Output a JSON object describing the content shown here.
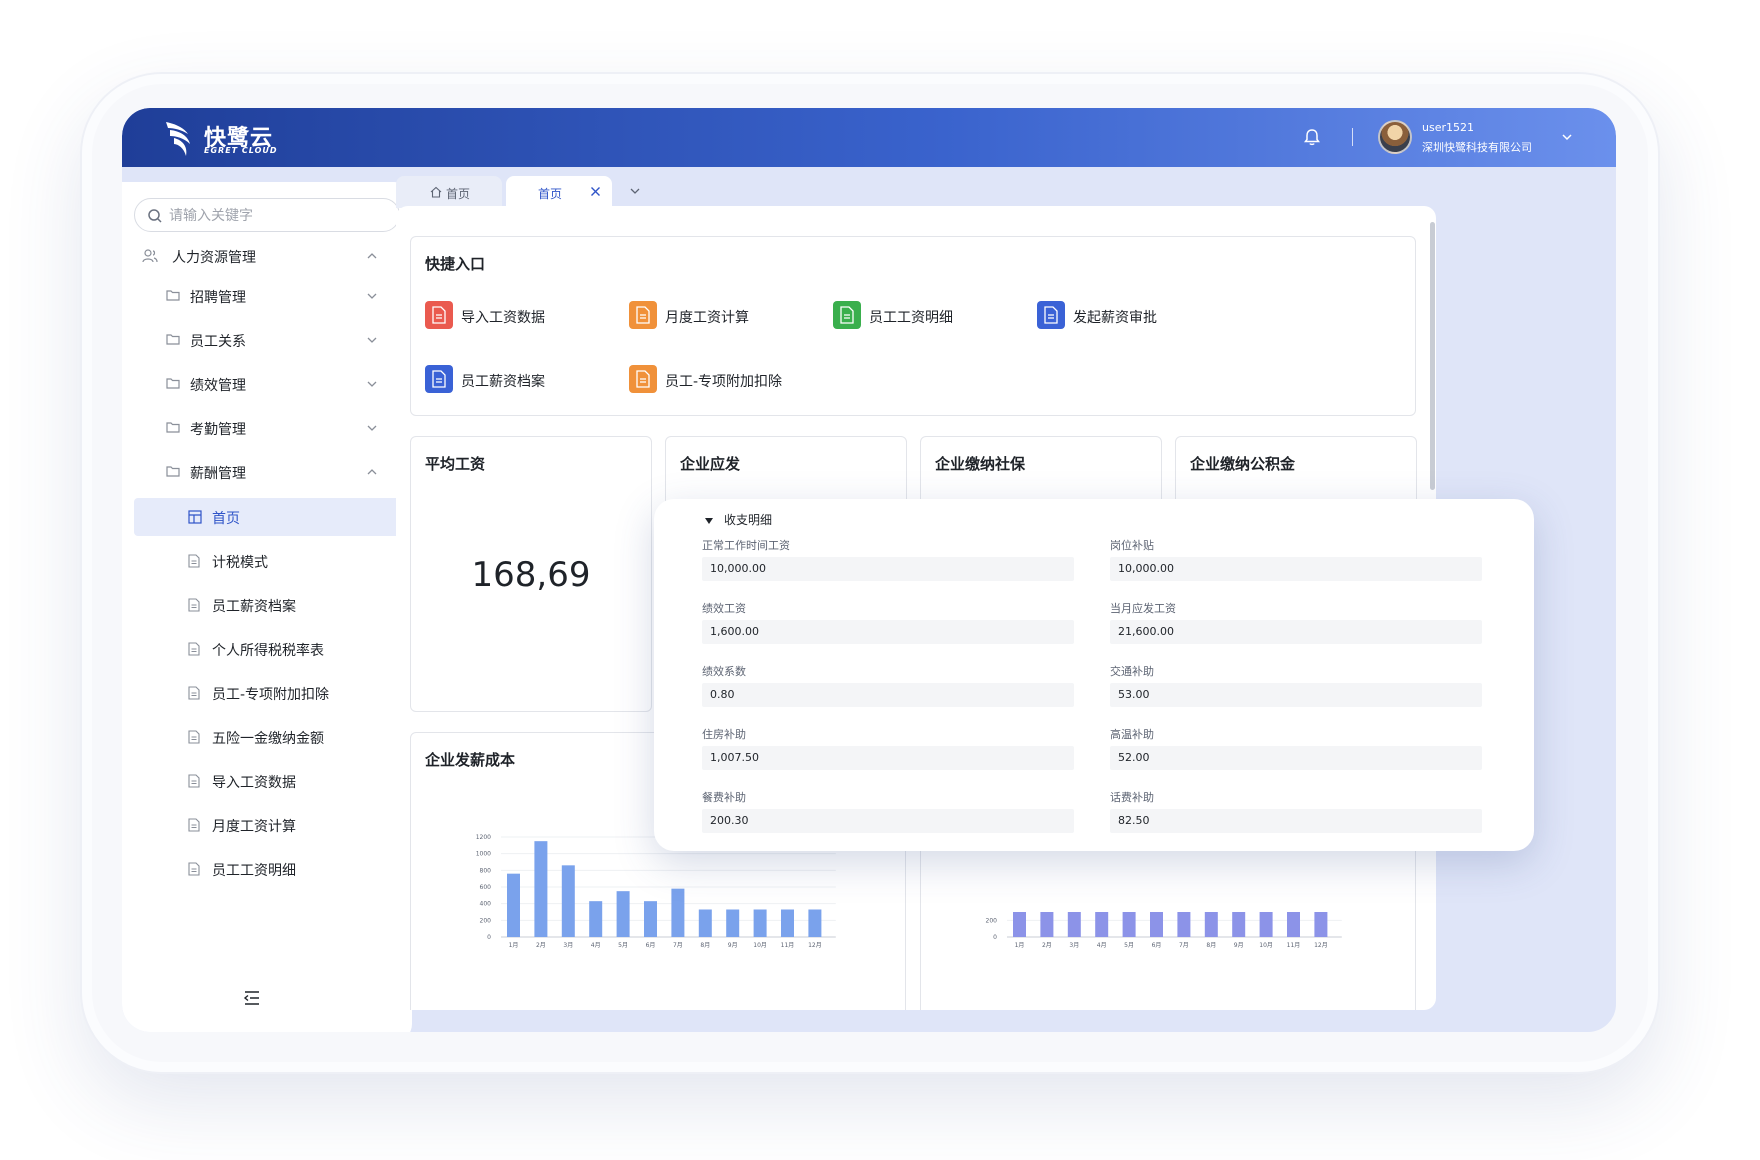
{
  "brand": {
    "name_cn": "快鹭云",
    "name_en": "EGRET CLOUD"
  },
  "user": {
    "name": "user1521",
    "company": "深圳快鹭科技有限公司"
  },
  "search": {
    "placeholder": "请输入关键字"
  },
  "sidebar": {
    "root": "人力资源管理",
    "groups": [
      "招聘管理",
      "员工关系",
      "绩效管理",
      "考勤管理",
      "薪酬管理"
    ],
    "sub_items": [
      "首页",
      "计税模式",
      "员工薪资档案",
      "个人所得税税率表",
      "员工-专项附加扣除",
      "五险一金缴纳金额",
      "导入工资数据",
      "月度工资计算",
      "员工工资明细"
    ]
  },
  "tabs": [
    "首页",
    "首页"
  ],
  "quick": {
    "title": "快捷入口",
    "items": [
      {
        "label": "导入工资数据",
        "color": "#ea5a4f"
      },
      {
        "label": "月度工资计算",
        "color": "#f0913a"
      },
      {
        "label": "员工工资明细",
        "color": "#3aaf4d"
      },
      {
        "label": "发起薪资审批",
        "color": "#3a62d6"
      },
      {
        "label": "员工薪资档案",
        "color": "#3a62d6"
      },
      {
        "label": "员工-专项附加扣除",
        "color": "#f0913a"
      }
    ]
  },
  "stats": [
    {
      "title": "平均工资",
      "value": "168,69"
    },
    {
      "title": "企业应发",
      "value": ""
    },
    {
      "title": "企业缴纳社保",
      "value": ""
    },
    {
      "title": "企业缴纳公积金",
      "value": ""
    }
  ],
  "cost_chart_title": "企业发薪成本",
  "chart_data": [
    {
      "type": "bar",
      "categories": [
        "1月",
        "2月",
        "3月",
        "4月",
        "5月",
        "6月",
        "7月",
        "8月",
        "9月",
        "10月",
        "11月",
        "12月"
      ],
      "values": [
        760,
        1150,
        860,
        430,
        550,
        430,
        580,
        330,
        330,
        330,
        330,
        330
      ],
      "ylim": [
        0,
        1200
      ],
      "yticks": [
        0,
        200,
        400,
        600,
        800,
        1000,
        1200
      ],
      "color": "#7aa2ec"
    },
    {
      "type": "bar",
      "categories": [
        "1月",
        "2月",
        "3月",
        "4月",
        "5月",
        "6月",
        "7月",
        "8月",
        "9月",
        "10月",
        "11月",
        "12月"
      ],
      "values": [
        300,
        300,
        300,
        300,
        300,
        300,
        300,
        300,
        300,
        300,
        300,
        300
      ],
      "yticks": [
        0,
        200
      ],
      "color": "#8c93e8"
    }
  ],
  "popup": {
    "title": "收支明细",
    "fields": [
      {
        "label": "正常工作时间工资",
        "value": "10,000.00"
      },
      {
        "label": "岗位补贴",
        "value": "10,000.00"
      },
      {
        "label": "绩效工资",
        "value": "1,600.00"
      },
      {
        "label": "当月应发工资",
        "value": "21,600.00"
      },
      {
        "label": "绩效系数",
        "value": "0.80"
      },
      {
        "label": "交通补助",
        "value": "53.00"
      },
      {
        "label": "住房补助",
        "value": "1,007.50"
      },
      {
        "label": "高温补助",
        "value": "52.00"
      },
      {
        "label": "餐费补助",
        "value": "200.30"
      },
      {
        "label": "话费补助",
        "value": "82.50"
      }
    ]
  }
}
